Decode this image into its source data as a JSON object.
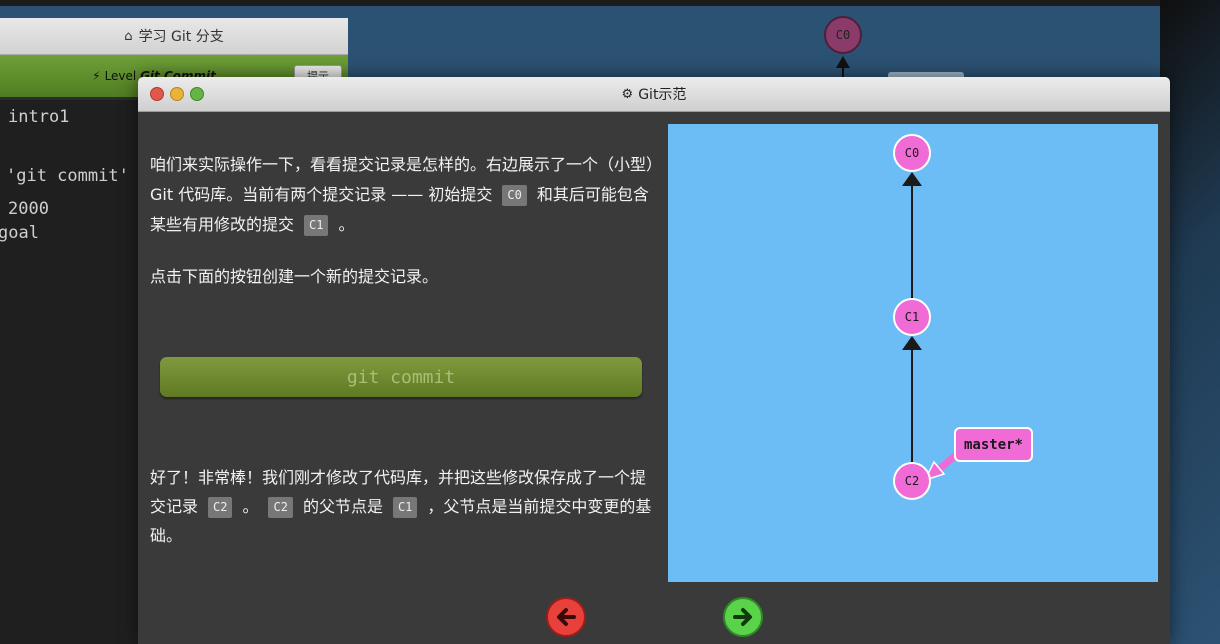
{
  "background": {
    "sidebar_title": "学习 Git 分支",
    "level_prefix": "Level",
    "level_name": "Git Commit",
    "level_button": "提示",
    "terminal_lines": [
      "intro1",
      "'git commit'",
      "2000",
      "goal"
    ],
    "graph_node": "C0"
  },
  "modal": {
    "title": "Git示范",
    "intro": {
      "part1": "咱们来实际操作一下，看看提交记录是怎样的。右边展示了一个（小型）Git 代码库。当前有两个提交记录 —— 初始提交",
      "code1": "C0",
      "part2": "和其后可能包含某些有用修改的提交",
      "code2": "C1",
      "part3": "。"
    },
    "instruction": "点击下面的按钮创建一个新的提交记录。",
    "commit_button": "git commit",
    "result": {
      "part1": "好了！非常棒！我们刚才修改了代码库，并把这些修改保存成了一个提交记录",
      "code1": "C2",
      "part2": "。",
      "code2": "C2",
      "part3": "的父节点是",
      "code3": "C1",
      "part4": "，父节点是当前提交中变更的基础。"
    },
    "graph": {
      "nodes": [
        "C0",
        "C1",
        "C2"
      ],
      "branch": "master*"
    }
  },
  "colors": {
    "commit_node": "#f06bd6",
    "graph_bg": "#6cbdf5",
    "prev_button": "#e8403b",
    "next_button": "#5ad24a"
  },
  "icons": [
    "home-icon",
    "bolt-icon",
    "gear-icon",
    "left-arrow-icon",
    "right-arrow-icon"
  ]
}
